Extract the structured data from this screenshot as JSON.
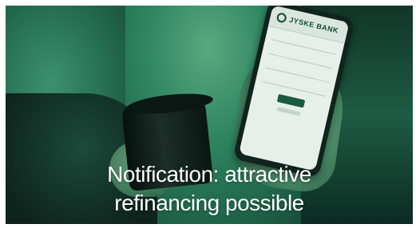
{
  "image": {
    "caption_line_1": "Notification: attractive",
    "caption_line_2": "refinancing possible",
    "phone": {
      "bank_name": "JYSKE BANK",
      "logo_icon": "bank-logo-icon"
    },
    "colors": {
      "overlay_green": "#2e8a63",
      "caption_text": "#ffffff",
      "phone_screen": "#e7efe9",
      "bank_brand": "#0f4b36"
    }
  }
}
